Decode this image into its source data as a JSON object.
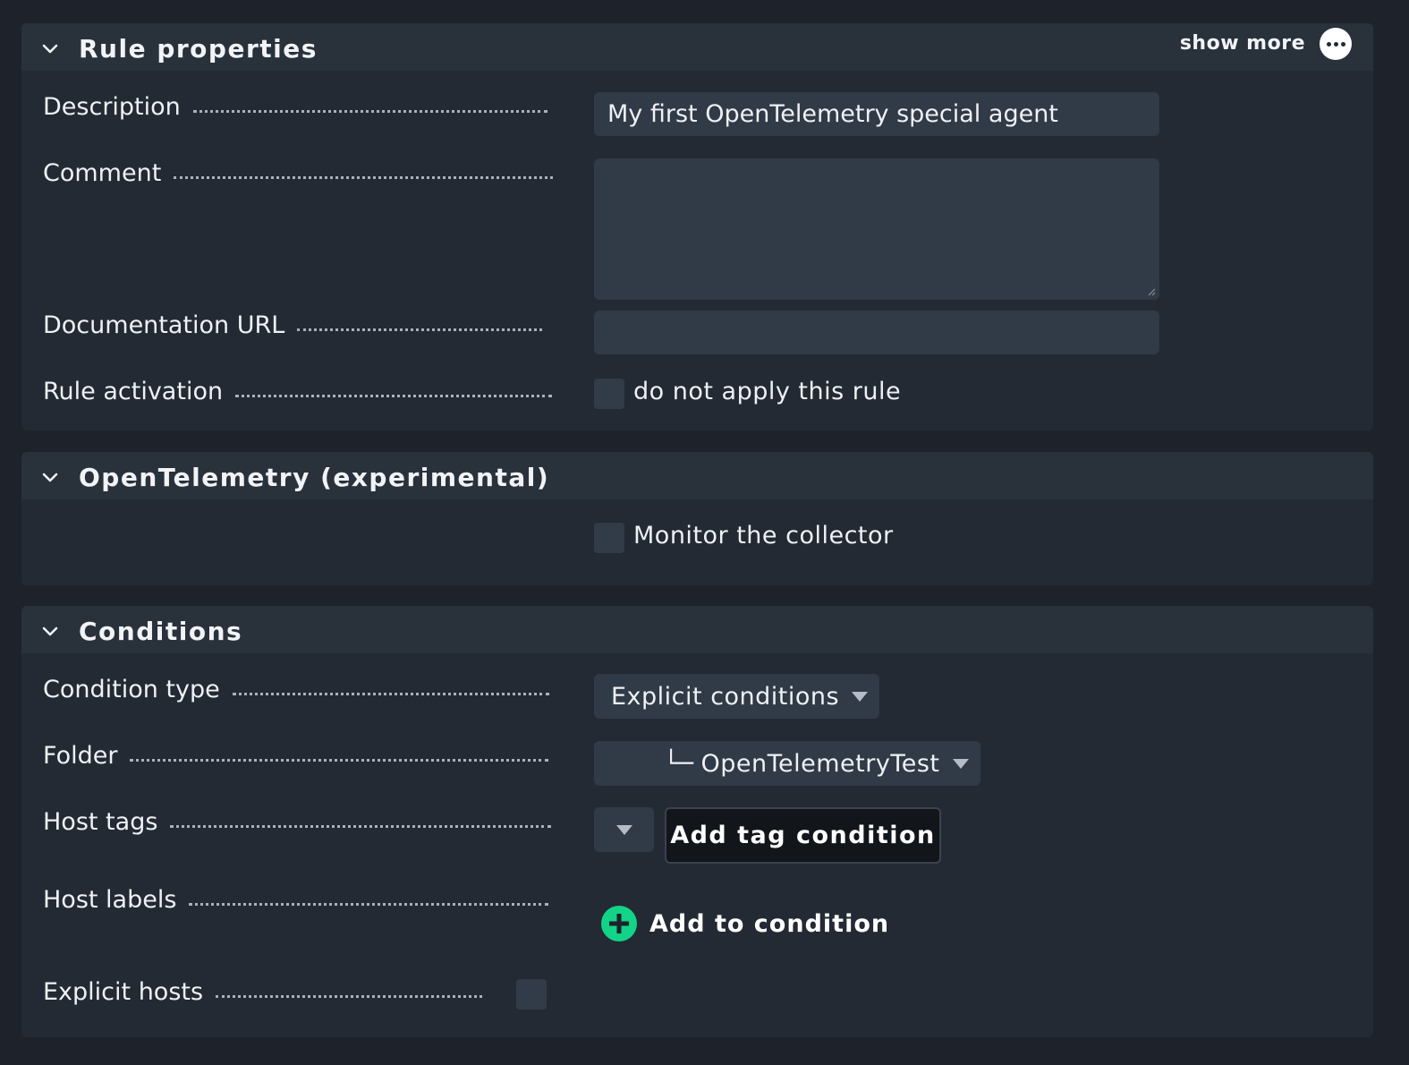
{
  "rule_properties": {
    "title": "Rule properties",
    "show_more_label": "show more",
    "description": {
      "label": "Description",
      "value": "My first OpenTelemetry special agent"
    },
    "comment": {
      "label": "Comment",
      "value": ""
    },
    "documentation_url": {
      "label": "Documentation URL",
      "value": ""
    },
    "rule_activation": {
      "label": "Rule activation",
      "checkbox_label": "do not apply this rule",
      "checked": false
    }
  },
  "opentelemetry": {
    "title": "OpenTelemetry (experimental)",
    "monitor_collector": {
      "checkbox_label": "Monitor the collector",
      "checked": false
    }
  },
  "conditions": {
    "title": "Conditions",
    "condition_type": {
      "label": "Condition type",
      "selected": "Explicit conditions"
    },
    "folder": {
      "label": "Folder",
      "tree_prefix": "└─",
      "selected": "OpenTelemetryTest"
    },
    "host_tags": {
      "label": "Host tags",
      "add_button": "Add tag condition"
    },
    "host_labels": {
      "label": "Host labels",
      "add_label": "Add to condition"
    },
    "explicit_hosts": {
      "label": "Explicit hosts",
      "checked": false
    }
  },
  "icons": {
    "collapse": "chevron-down-icon",
    "more": "more-dots-icon",
    "add": "plus-circle-icon",
    "dropdown": "caret-down-icon"
  },
  "colors": {
    "background": "#1d222b",
    "panel": "#232a33",
    "header": "#29313b",
    "input": "#313a47",
    "accent_green": "#13d389"
  }
}
